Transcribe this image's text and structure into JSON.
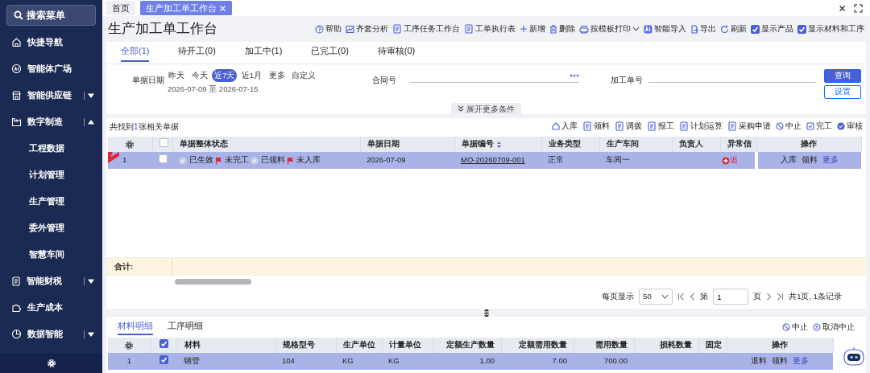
{
  "sidebar": {
    "search": "搜索菜单",
    "items": [
      {
        "label": "快捷导航",
        "kind": "item"
      },
      {
        "label": "智能体广场",
        "kind": "item"
      },
      {
        "label": "智能供应链",
        "kind": "group",
        "expanded": false
      },
      {
        "label": "数字制造",
        "kind": "group",
        "expanded": true,
        "children": [
          {
            "label": "工程数据"
          },
          {
            "label": "计划管理"
          },
          {
            "label": "生产管理"
          },
          {
            "label": "委外管理"
          },
          {
            "label": "智慧车间"
          }
        ]
      },
      {
        "label": "智能财税",
        "kind": "group",
        "expanded": false
      },
      {
        "label": "生产成本",
        "kind": "item"
      },
      {
        "label": "数据智能",
        "kind": "group",
        "expanded": false
      }
    ]
  },
  "page_tabs": [
    {
      "label": "首页",
      "selected": false,
      "closable": false
    },
    {
      "label": "生产加工单工作台",
      "selected": true,
      "closable": true
    }
  ],
  "title": "生产加工单工作台",
  "toolbar": [
    {
      "label": "帮助",
      "kind": "action"
    },
    {
      "label": "齐套分析",
      "kind": "action"
    },
    {
      "label": "工序任务工作台",
      "kind": "action"
    },
    {
      "label": "工单执行表",
      "kind": "action"
    },
    {
      "label": "新增",
      "kind": "action"
    },
    {
      "label": "删除",
      "kind": "action"
    },
    {
      "label": "按模板打印",
      "kind": "dropdown"
    },
    {
      "label": "智能导入",
      "kind": "action"
    },
    {
      "label": "导出",
      "kind": "action"
    },
    {
      "label": "刷新",
      "kind": "action"
    },
    {
      "label": "显示产品",
      "kind": "checkbox",
      "checked": true
    },
    {
      "label": "显示材料和工序",
      "kind": "checkbox",
      "checked": true
    }
  ],
  "status_tabs": [
    {
      "label": "全部(1)",
      "selected": true
    },
    {
      "label": "待开工(0)",
      "selected": false
    },
    {
      "label": "加工中(1)",
      "selected": false
    },
    {
      "label": "已完工(0)",
      "selected": false
    },
    {
      "label": "待审核(0)",
      "selected": false
    }
  ],
  "filters": {
    "date": {
      "label": "单据日期",
      "presets": [
        {
          "label": "昨天",
          "selected": false
        },
        {
          "label": "今天",
          "selected": false
        },
        {
          "label": "近7天",
          "selected": true
        },
        {
          "label": "近1月",
          "selected": false
        },
        {
          "label": "更多",
          "selected": false
        },
        {
          "label": "自定义",
          "selected": false
        }
      ],
      "range": "2026-07-09 至 2026-07-15"
    },
    "contract": {
      "label": "合同号"
    },
    "order_no": {
      "label": "加工单号"
    },
    "query": "查询",
    "settings": "设置",
    "expand": "展开更多条件"
  },
  "results": {
    "summary": {
      "before": "共找到",
      "count": "1",
      "after": "张相关单据"
    },
    "actions": [
      "入库",
      "领料",
      "调拨",
      "报工",
      "计划运算",
      "采购申请",
      "中止",
      "完工",
      "审核"
    ],
    "select_all": {
      "checked": false
    },
    "columns": [
      {
        "label": "单据整体状态"
      },
      {
        "label": "单据日期"
      },
      {
        "label": "单据编号",
        "sortable": true
      },
      {
        "label": "业务类型"
      },
      {
        "label": "生产车间"
      },
      {
        "label": "负责人"
      },
      {
        "label": "异常信"
      },
      {
        "label": "操作"
      }
    ],
    "rows": [
      {
        "index": "1",
        "selected": true,
        "checked": false,
        "statuses": [
          {
            "label": "已生效",
            "kind": "check"
          },
          {
            "label": "未完工",
            "kind": "flag"
          },
          {
            "label": "已领料",
            "kind": "check"
          },
          {
            "label": "未入库",
            "kind": "flag"
          }
        ],
        "date": "2026-07-09",
        "number": "MO-20260709-001",
        "type": "正常",
        "workshop": "车间一",
        "exception": "追",
        "ops": [
          "入库",
          "领料",
          "更多"
        ]
      }
    ],
    "total_label": "合计:"
  },
  "pagination": {
    "page_size_label": "每页显示",
    "page_size": "50",
    "page_prefix": "第",
    "page": "1",
    "page_suffix": "页",
    "summary": "共1页, 1条记录"
  },
  "detail": {
    "tabs": [
      {
        "label": "材料明细",
        "selected": true
      },
      {
        "label": "工序明细",
        "selected": false
      }
    ],
    "actions": [
      "中止",
      "取消中止"
    ],
    "select_all": {
      "checked": true
    },
    "columns": [
      "材料",
      "规格型号",
      "生产单位",
      "计量单位",
      "定额生产数量",
      "定额需用数量",
      "需用数量",
      "损耗数量",
      "固定",
      "操作"
    ],
    "rows": [
      {
        "index": "1",
        "checked": true,
        "selected": true,
        "cells": [
          "钢管",
          "104",
          "KG",
          "KG",
          "1.00",
          "7.00",
          "700.00",
          "",
          ""
        ],
        "ops": [
          "退料",
          "领料",
          "更多"
        ]
      }
    ]
  }
}
